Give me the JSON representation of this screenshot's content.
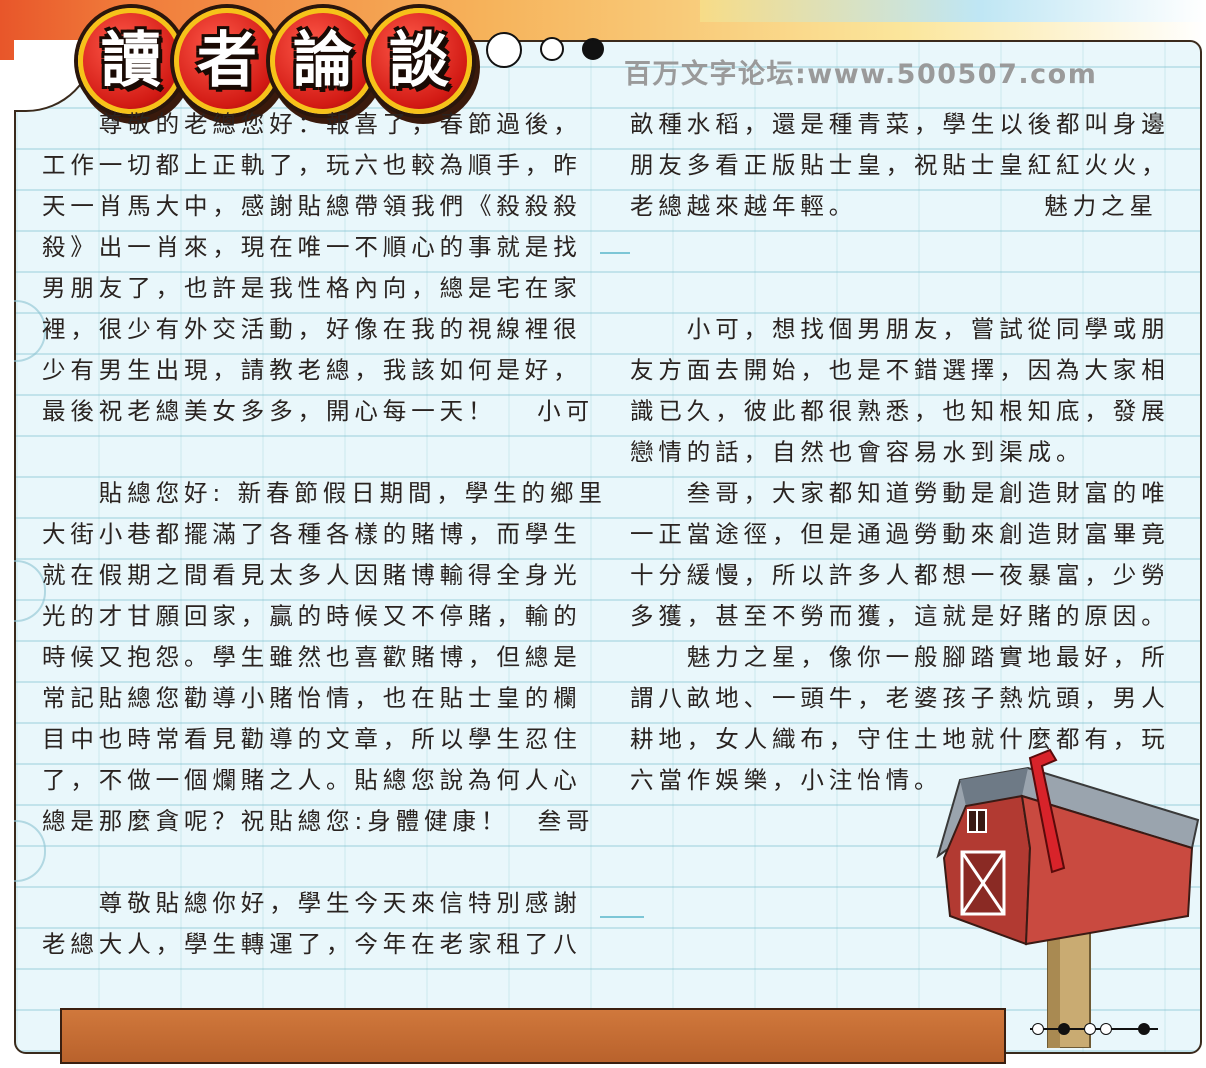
{
  "header": {
    "title_chars": [
      "讀",
      "者",
      "論",
      "談"
    ],
    "watermark": "百万文字论坛:www.500507.com"
  },
  "left_column": [
    "　　尊敬的老總您好：報喜了，春節過後，",
    "工作一切都上正軌了，玩六也較為順手，昨",
    "天一肖馬大中，感謝貼總帶領我們《殺殺殺",
    "殺》出一肖來，現在唯一不順心的事就是找",
    "男朋友了，也許是我性格內向，總是宅在家",
    "裡，很少有外交活動，好像在我的視線裡很",
    "少有男生出現，請教老總，我該如何是好，",
    "最後祝老總美女多多，開心每一天！　 小可",
    "",
    "　　貼總您好: 新春節假日期間，學生的鄉里",
    "大街小巷都擺滿了各種各樣的賭博，而學生",
    "就在假期之間看見太多人因賭博輸得全身光",
    "光的才甘願回家，贏的時候又不停賭，輸的",
    "時候又抱怨。學生雖然也喜歡賭博，但總是",
    "常記貼總您勸導小賭怡情，也在貼士皇的欄",
    "目中也時常看見勸導的文章，所以學生忍住",
    "了，不做一個爛賭之人。貼總您說為何人心",
    "總是那麼貪呢？祝貼總您:身體健康！　叁哥",
    "",
    "　　尊敬貼總你好，學生今天來信特別感謝",
    "老總大人，學生轉運了，今年在老家租了八"
  ],
  "right_column": [
    "畝種水稻，還是種青菜，學生以後都叫身邊",
    "朋友多看正版貼士皇，祝貼士皇紅紅火火，",
    "老總越來越年輕。　　　　　　　魅力之星",
    "",
    "",
    "　　小可，想找個男朋友，嘗試從同學或朋",
    "友方面去開始，也是不錯選擇，因為大家相",
    "識已久，彼此都很熟悉，也知根知底，發展",
    "戀情的話，自然也會容易水到渠成。",
    "　　叁哥，大家都知道勞動是創造財富的唯",
    "一正當途徑，但是通過勞動來創造財富畢竟",
    "十分緩慢，所以許多人都想一夜暴富，少勞",
    "多獲，甚至不勞而獲，這就是好賭的原因。",
    "　　魅力之星，像你一般腳踏實地最好，所",
    "謂八畝地、一頭牛，老婆孩子熱炕頭，男人",
    "耕地，女人織布，守住土地就什麼都有，玩",
    "六當作娛樂，小注怡情。"
  ],
  "colors": {
    "panel_background": "#e9f7fb",
    "badge_red": "#d21a14",
    "badge_ring": "#f6c21a",
    "text": "#2a2320",
    "bottom_bar": "#c26a32",
    "watermark": "#9a9a9a"
  },
  "icons": [
    "mailbox-illustration"
  ]
}
